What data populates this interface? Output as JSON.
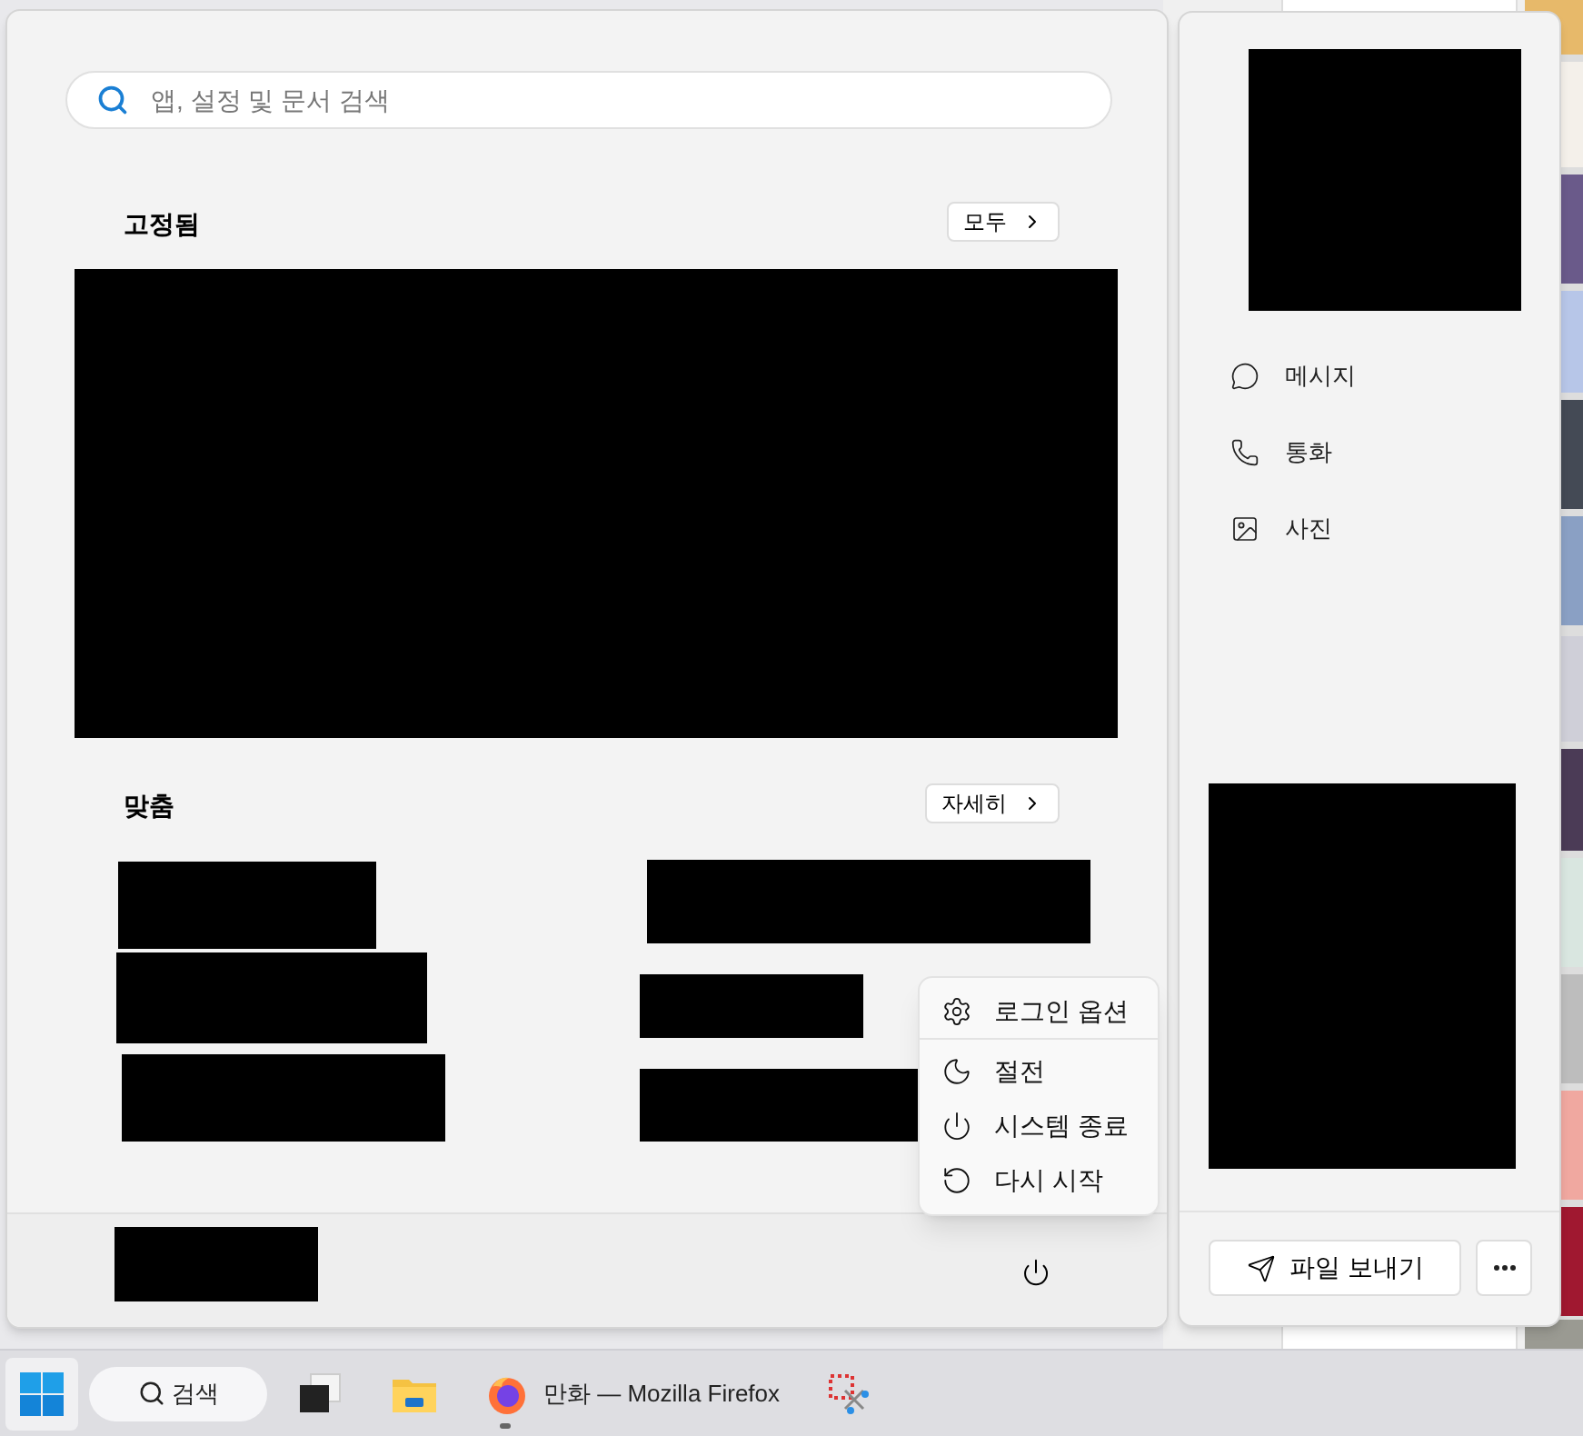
{
  "search": {
    "placeholder": "앱, 설정 및 문서 검색"
  },
  "pinned": {
    "title": "고정됨",
    "button": "모두"
  },
  "recommended": {
    "title": "맞춤",
    "button": "자세히"
  },
  "power_menu": [
    {
      "kind": "gear",
      "label": "로그인 옵션",
      "divider_after": true
    },
    {
      "kind": "moon",
      "label": "절전",
      "divider_after": false
    },
    {
      "kind": "power",
      "label": "시스템 종료",
      "divider_after": false
    },
    {
      "kind": "restart",
      "label": "다시 시작",
      "divider_after": false
    }
  ],
  "side_panel": {
    "actions": [
      {
        "kind": "message",
        "label": "메시지"
      },
      {
        "kind": "call",
        "label": "통화"
      },
      {
        "label": "사진"
      }
    ],
    "send_button": "파일 보내기"
  },
  "taskbar": {
    "search_label": "검색",
    "apps": [
      {
        "kind": "taskview",
        "running": false
      },
      {
        "kind": "explorer",
        "running": false
      },
      {
        "kind": "firefox",
        "label": "만화 — Mozilla Firefox",
        "running": true
      },
      {
        "kind": "snip",
        "running": false
      }
    ]
  }
}
